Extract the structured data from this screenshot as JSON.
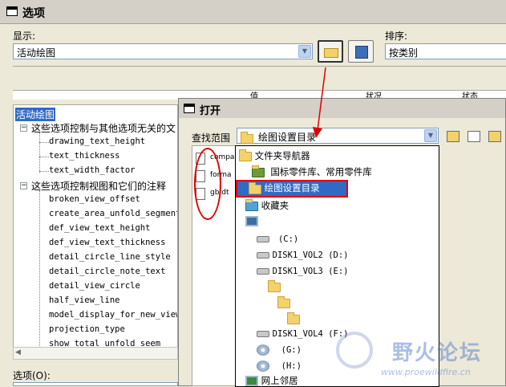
{
  "window": {
    "title": "选项"
  },
  "display": {
    "label": "显示:",
    "value": "活动绘图",
    "sort_label": "排序:",
    "sort_value": "按类别"
  },
  "table_headers": [
    "值",
    "状况",
    "状态"
  ],
  "tree": {
    "selected": "活动绘图",
    "group1": "这些选项控制与其他选项无关的文",
    "group1_items": [
      "drawing_text_height",
      "text_thickness",
      "text_width_factor"
    ],
    "group2": "这些选项控制视图和它们的注释",
    "group2_items": [
      "broken_view_offset",
      "create_area_unfold_segmente",
      "def_view_text_height",
      "def_view_text_thickness",
      "detail_circle_line_style",
      "detail_circle_note_text",
      "detail_view_circle",
      "half_view_line",
      "model_display_for_new_views",
      "projection_type",
      "show_total_unfold_seem"
    ]
  },
  "options_label": "选项(O):",
  "open_dialog": {
    "title": "打开",
    "lookin_label": "查找范围",
    "lookin_value": "绘图设置目录",
    "files": [
      "compa",
      "forma",
      "gb.dt"
    ],
    "dropdown": [
      {
        "icon": "folder-nav-icon",
        "label": "文件夹导航器",
        "indent": 0
      },
      {
        "icon": "library-icon",
        "label": "国标零件库、常用零件库",
        "indent": 1
      },
      {
        "icon": "folder-icon",
        "label": "绘图设置目录",
        "indent": 1,
        "selected": true
      },
      {
        "icon": "favorites-icon",
        "label": "收藏夹",
        "indent": 0
      },
      {
        "icon": "computer-icon",
        "label": "",
        "indent": 0
      },
      {
        "icon": "drive-icon",
        "label": "(C:)",
        "indent": 1
      },
      {
        "icon": "drive-icon",
        "label": "DISK1_VOL2 (D:)",
        "indent": 1
      },
      {
        "icon": "drive-icon",
        "label": "DISK1_VOL3 (E:)",
        "indent": 1
      },
      {
        "icon": "folder-icon",
        "label": "",
        "indent": 2
      },
      {
        "icon": "folder-icon",
        "label": "",
        "indent": 3
      },
      {
        "icon": "folder-icon",
        "label": "",
        "indent": 4
      },
      {
        "icon": "drive-icon",
        "label": "DISK1_VOL4 (F:)",
        "indent": 1
      },
      {
        "icon": "cd-drive-icon",
        "label": "(G:)",
        "indent": 1
      },
      {
        "icon": "cd-drive-icon",
        "label": "(H:)",
        "indent": 1
      },
      {
        "icon": "network-icon",
        "label": "网上邻居",
        "indent": 0
      }
    ]
  },
  "watermark": {
    "text": "野火论坛",
    "url": "www.proewildfire.cn"
  },
  "annotation_color": "#e00000"
}
